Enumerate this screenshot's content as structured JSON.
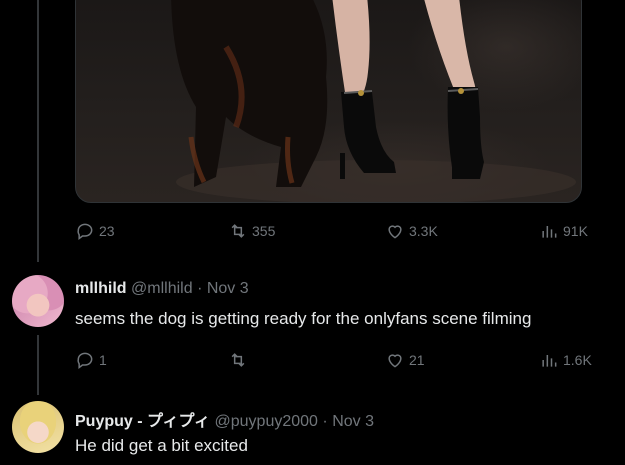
{
  "tweet": {
    "stats": {
      "replies": "23",
      "retweets": "355",
      "likes": "3.3K",
      "views": "91K"
    }
  },
  "replies": [
    {
      "display_name": "mllhild",
      "handle": "@mllhild",
      "separator": "·",
      "date": "Nov 3",
      "text": "seems the dog is getting ready for the onlyfans scene filming",
      "stats": {
        "replies": "1",
        "retweets": "",
        "likes": "21",
        "views": "1.6K"
      }
    },
    {
      "display_name": "Puypuy - プィプィ",
      "handle": "@puypuy2000",
      "separator": "·",
      "date": "Nov 3",
      "text": "He did get a bit excited"
    }
  ],
  "icons": {
    "reply": "speech-bubble-icon",
    "retweet": "retweet-arrows-icon",
    "like": "heart-icon",
    "views": "bar-chart-icon"
  },
  "colors": {
    "background": "#000000",
    "text": "#e7e9ea",
    "muted": "#71767b",
    "border": "#2f3336"
  }
}
